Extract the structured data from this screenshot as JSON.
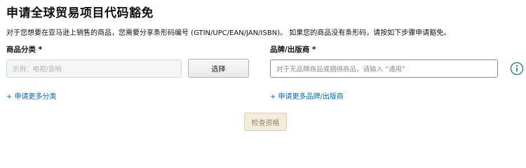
{
  "page": {
    "title": "申请全球贸易项目代码豁免",
    "description": "对于您想要在亚马逊上销售的商品，您需要分享条形码编号 (GTIN/UPC/EAN/JAN/ISBN)。 如果您的商品没有条形码，请按如下步骤申请豁免。"
  },
  "category": {
    "label": "商品分类 *",
    "placeholder": "示例：电视/音响",
    "select_button": "选择",
    "more_link": "+ 申请更多分类"
  },
  "brand": {
    "label": "品牌/出版商 *",
    "placeholder": "对于无品牌商品或捆绑商品，请输入 “通用”",
    "more_link": "+ 申请更多品牌/出版商",
    "info_icon": "info-icon"
  },
  "actions": {
    "check_button": "检查资格"
  },
  "colors": {
    "link": "#0066c0",
    "info_icon": "#1a7a8c",
    "check_button_bg": "#f5ecd8"
  }
}
